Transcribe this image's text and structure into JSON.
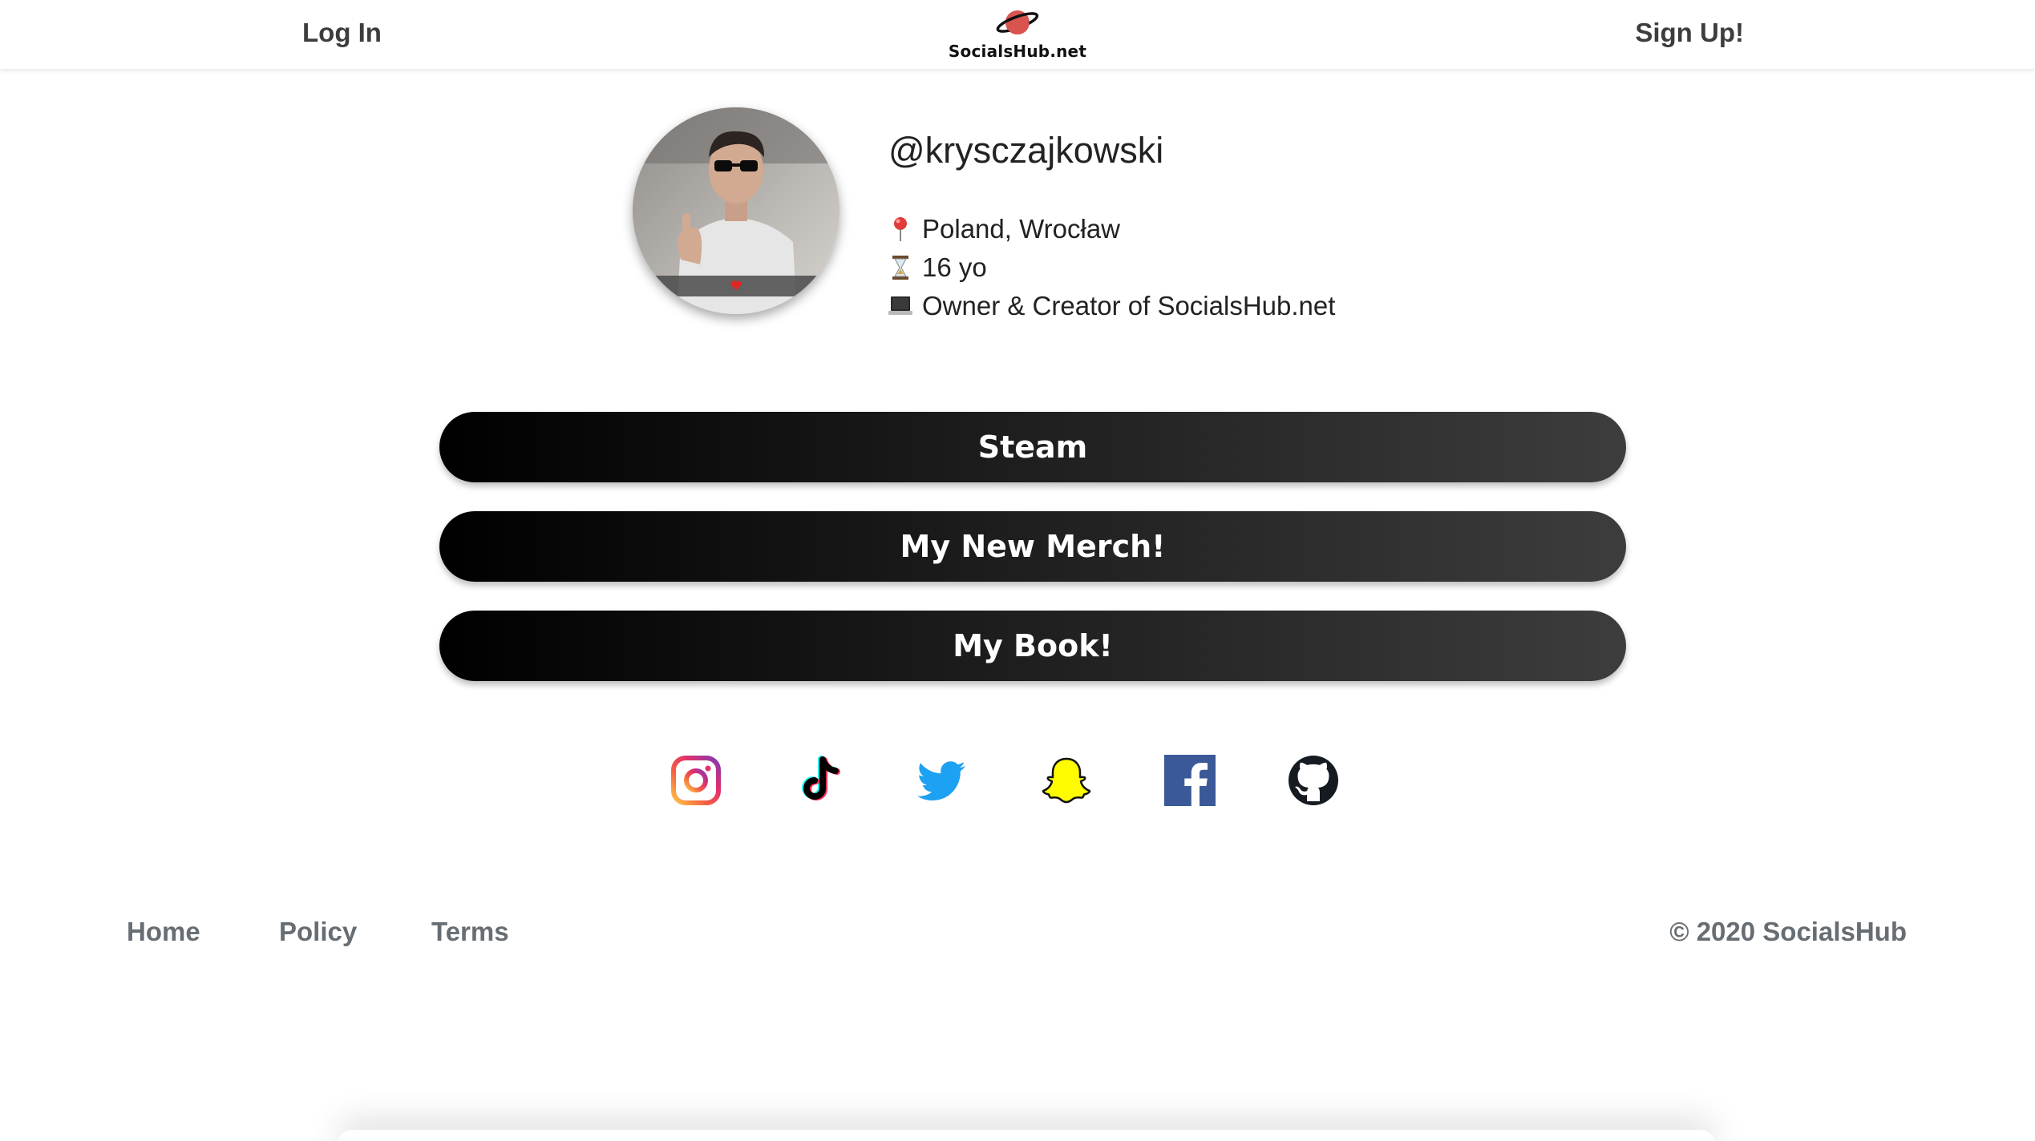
{
  "header": {
    "login_label": "Log In",
    "signup_label": "Sign Up!",
    "brand_name": "SocialsHub.net",
    "brand_icon": "planet-icon",
    "brand_color": "#d9534f"
  },
  "profile": {
    "handle": "@krysczajkowski",
    "avatar_icon": "profile-photo",
    "info": [
      {
        "icon": "pin-icon",
        "text": "Poland, Wrocław"
      },
      {
        "icon": "hourglass-icon",
        "text": "16 yo"
      },
      {
        "icon": "laptop-icon",
        "text": "Owner & Creator of SocialsHub.net"
      }
    ]
  },
  "links": [
    {
      "label": "Steam"
    },
    {
      "label": "My New Merch!"
    },
    {
      "label": "My Book!"
    }
  ],
  "socials": [
    {
      "name": "instagram-icon"
    },
    {
      "name": "tiktok-icon"
    },
    {
      "name": "twitter-icon"
    },
    {
      "name": "snapchat-icon"
    },
    {
      "name": "facebook-icon"
    },
    {
      "name": "github-icon"
    }
  ],
  "footer": {
    "links": [
      "Home",
      "Policy",
      "Terms"
    ],
    "copyright": "© 2020 SocialsHub"
  }
}
